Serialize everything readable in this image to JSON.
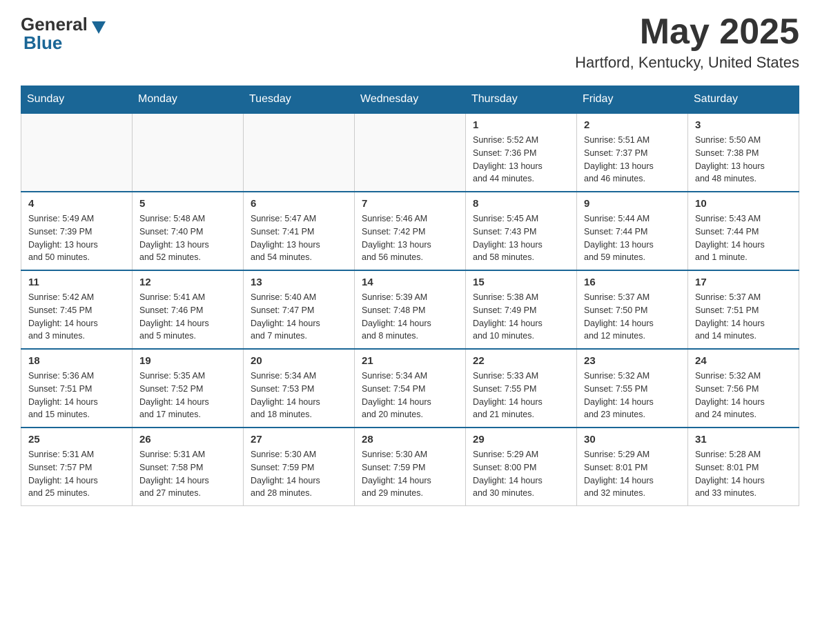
{
  "header": {
    "logo_general": "General",
    "logo_blue": "Blue",
    "month_title": "May 2025",
    "location": "Hartford, Kentucky, United States"
  },
  "days_of_week": [
    "Sunday",
    "Monday",
    "Tuesday",
    "Wednesday",
    "Thursday",
    "Friday",
    "Saturday"
  ],
  "weeks": [
    [
      {
        "day": "",
        "info": ""
      },
      {
        "day": "",
        "info": ""
      },
      {
        "day": "",
        "info": ""
      },
      {
        "day": "",
        "info": ""
      },
      {
        "day": "1",
        "info": "Sunrise: 5:52 AM\nSunset: 7:36 PM\nDaylight: 13 hours\nand 44 minutes."
      },
      {
        "day": "2",
        "info": "Sunrise: 5:51 AM\nSunset: 7:37 PM\nDaylight: 13 hours\nand 46 minutes."
      },
      {
        "day": "3",
        "info": "Sunrise: 5:50 AM\nSunset: 7:38 PM\nDaylight: 13 hours\nand 48 minutes."
      }
    ],
    [
      {
        "day": "4",
        "info": "Sunrise: 5:49 AM\nSunset: 7:39 PM\nDaylight: 13 hours\nand 50 minutes."
      },
      {
        "day": "5",
        "info": "Sunrise: 5:48 AM\nSunset: 7:40 PM\nDaylight: 13 hours\nand 52 minutes."
      },
      {
        "day": "6",
        "info": "Sunrise: 5:47 AM\nSunset: 7:41 PM\nDaylight: 13 hours\nand 54 minutes."
      },
      {
        "day": "7",
        "info": "Sunrise: 5:46 AM\nSunset: 7:42 PM\nDaylight: 13 hours\nand 56 minutes."
      },
      {
        "day": "8",
        "info": "Sunrise: 5:45 AM\nSunset: 7:43 PM\nDaylight: 13 hours\nand 58 minutes."
      },
      {
        "day": "9",
        "info": "Sunrise: 5:44 AM\nSunset: 7:44 PM\nDaylight: 13 hours\nand 59 minutes."
      },
      {
        "day": "10",
        "info": "Sunrise: 5:43 AM\nSunset: 7:44 PM\nDaylight: 14 hours\nand 1 minute."
      }
    ],
    [
      {
        "day": "11",
        "info": "Sunrise: 5:42 AM\nSunset: 7:45 PM\nDaylight: 14 hours\nand 3 minutes."
      },
      {
        "day": "12",
        "info": "Sunrise: 5:41 AM\nSunset: 7:46 PM\nDaylight: 14 hours\nand 5 minutes."
      },
      {
        "day": "13",
        "info": "Sunrise: 5:40 AM\nSunset: 7:47 PM\nDaylight: 14 hours\nand 7 minutes."
      },
      {
        "day": "14",
        "info": "Sunrise: 5:39 AM\nSunset: 7:48 PM\nDaylight: 14 hours\nand 8 minutes."
      },
      {
        "day": "15",
        "info": "Sunrise: 5:38 AM\nSunset: 7:49 PM\nDaylight: 14 hours\nand 10 minutes."
      },
      {
        "day": "16",
        "info": "Sunrise: 5:37 AM\nSunset: 7:50 PM\nDaylight: 14 hours\nand 12 minutes."
      },
      {
        "day": "17",
        "info": "Sunrise: 5:37 AM\nSunset: 7:51 PM\nDaylight: 14 hours\nand 14 minutes."
      }
    ],
    [
      {
        "day": "18",
        "info": "Sunrise: 5:36 AM\nSunset: 7:51 PM\nDaylight: 14 hours\nand 15 minutes."
      },
      {
        "day": "19",
        "info": "Sunrise: 5:35 AM\nSunset: 7:52 PM\nDaylight: 14 hours\nand 17 minutes."
      },
      {
        "day": "20",
        "info": "Sunrise: 5:34 AM\nSunset: 7:53 PM\nDaylight: 14 hours\nand 18 minutes."
      },
      {
        "day": "21",
        "info": "Sunrise: 5:34 AM\nSunset: 7:54 PM\nDaylight: 14 hours\nand 20 minutes."
      },
      {
        "day": "22",
        "info": "Sunrise: 5:33 AM\nSunset: 7:55 PM\nDaylight: 14 hours\nand 21 minutes."
      },
      {
        "day": "23",
        "info": "Sunrise: 5:32 AM\nSunset: 7:55 PM\nDaylight: 14 hours\nand 23 minutes."
      },
      {
        "day": "24",
        "info": "Sunrise: 5:32 AM\nSunset: 7:56 PM\nDaylight: 14 hours\nand 24 minutes."
      }
    ],
    [
      {
        "day": "25",
        "info": "Sunrise: 5:31 AM\nSunset: 7:57 PM\nDaylight: 14 hours\nand 25 minutes."
      },
      {
        "day": "26",
        "info": "Sunrise: 5:31 AM\nSunset: 7:58 PM\nDaylight: 14 hours\nand 27 minutes."
      },
      {
        "day": "27",
        "info": "Sunrise: 5:30 AM\nSunset: 7:59 PM\nDaylight: 14 hours\nand 28 minutes."
      },
      {
        "day": "28",
        "info": "Sunrise: 5:30 AM\nSunset: 7:59 PM\nDaylight: 14 hours\nand 29 minutes."
      },
      {
        "day": "29",
        "info": "Sunrise: 5:29 AM\nSunset: 8:00 PM\nDaylight: 14 hours\nand 30 minutes."
      },
      {
        "day": "30",
        "info": "Sunrise: 5:29 AM\nSunset: 8:01 PM\nDaylight: 14 hours\nand 32 minutes."
      },
      {
        "day": "31",
        "info": "Sunrise: 5:28 AM\nSunset: 8:01 PM\nDaylight: 14 hours\nand 33 minutes."
      }
    ]
  ]
}
